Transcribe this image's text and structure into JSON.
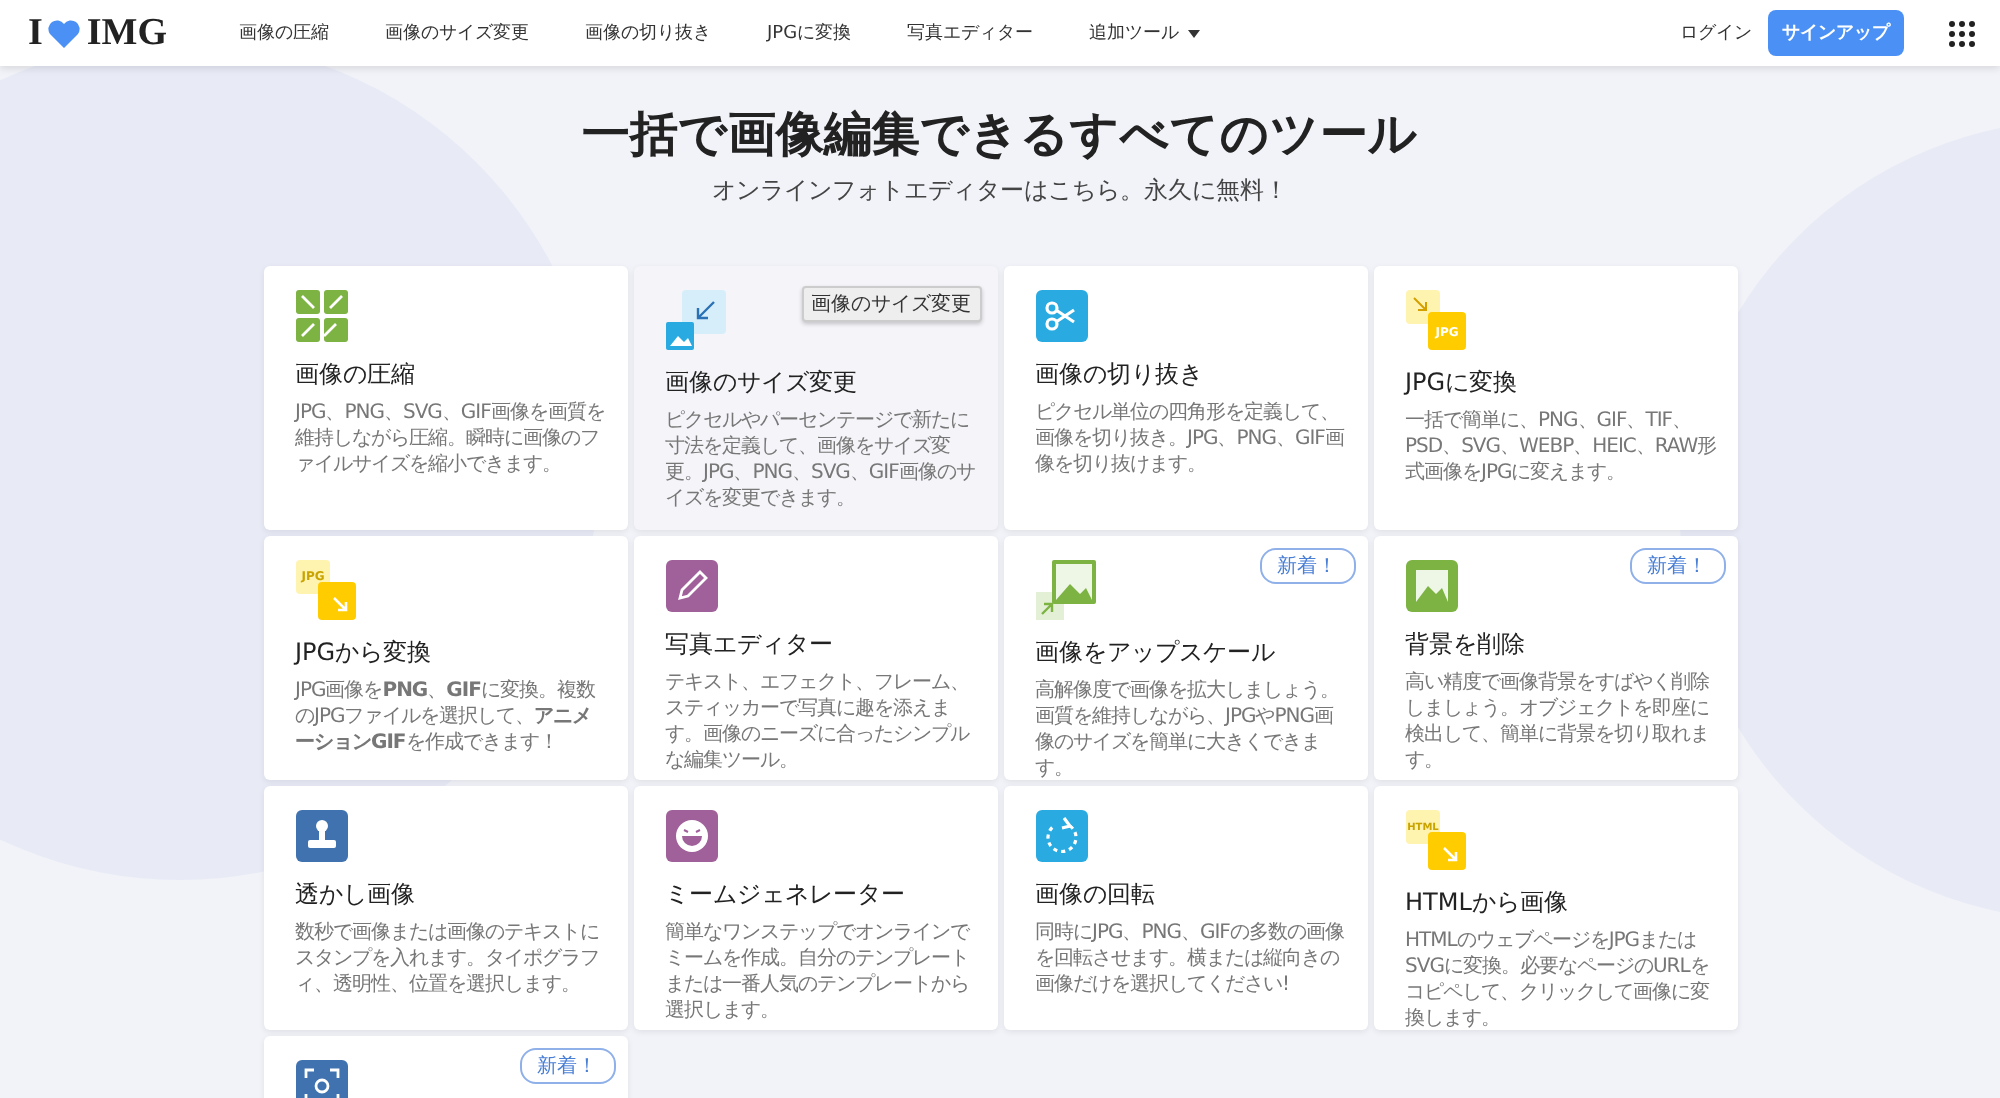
{
  "header": {
    "logo": {
      "left": "I",
      "right": "IMG"
    },
    "nav": [
      {
        "label": "画像の圧縮",
        "dropdown": false
      },
      {
        "label": "画像のサイズ変更",
        "dropdown": false
      },
      {
        "label": "画像の切り抜き",
        "dropdown": false
      },
      {
        "label": "JPGに変換",
        "dropdown": false
      },
      {
        "label": "写真エディター",
        "dropdown": false
      },
      {
        "label": "追加ツール",
        "dropdown": true
      }
    ],
    "login": "ログイン",
    "signup": "サインアップ"
  },
  "hero": {
    "title": "一括で画像編集できるすべてのツール",
    "subtitle": "オンラインフォトエディターはこちら。永久に無料！"
  },
  "tooltip": "画像のサイズ変更",
  "cards": [
    {
      "title": "画像の圧縮",
      "description": "JPG、PNG、SVG、GIF画像を画質を維持しながら圧縮。瞬時に画像のファイルサイズを縮小できます。",
      "icon": {
        "kind": "compress",
        "color": "#7cb342"
      },
      "hovered": false
    },
    {
      "title": "画像のサイズ変更",
      "description": "ピクセルやパーセンテージで新たに寸法を定義して、画像をサイズ変更。JPG、PNG、SVG、GIF画像のサイズを変更できます。",
      "icon": {
        "kind": "resize",
        "color": "#29abe2"
      },
      "hovered": true
    },
    {
      "title": "画像の切り抜き",
      "description": "ピクセル単位の四角形を定義して、画像を切り抜き。JPG、PNG、GIF画像を切り抜けます。",
      "icon": {
        "kind": "crop",
        "color": "#29abe2"
      },
      "hovered": false
    },
    {
      "title": "JPGに変換",
      "description": "一括で簡単に、PNG、GIF、TIF、PSD、SVG、WEBP、HEIC、RAW形式画像をJPGに変えます。",
      "icon": {
        "kind": "format",
        "color": "#ffcc00",
        "label": "JPG",
        "corner": true
      },
      "hovered": false
    },
    {
      "title": "JPGから変換",
      "description": "JPG画像を**PNG**、**GIF**に変換。複数のJPGファイルを選択して、**アニメーションGIF**を作成できます！",
      "icon": {
        "kind": "format",
        "color": "#ffcc00",
        "label": "JPG",
        "corner": false
      },
      "hovered": false
    },
    {
      "title": "写真エディター",
      "description": "テキスト、エフェクト、フレーム、スティッカーで写真に趣を添えます。画像のニーズに合ったシンプルな編集ツール。",
      "icon": {
        "kind": "pencil",
        "color": "#a0609a"
      },
      "hovered": false
    },
    {
      "title": "画像をアップスケール",
      "description": "高解像度で画像を拡大しましょう。画質を維持しながら、JPGやPNG画像のサイズを簡単に大きくできます。",
      "icon": {
        "kind": "upscale",
        "color": "#7cb342"
      },
      "badge": "新着！",
      "hovered": false
    },
    {
      "title": "背景を削除",
      "description": "高い精度で画像背景をすばやく削除しましょう。オブジェクトを即座に検出して、簡単に背景を切り取れます。",
      "icon": {
        "kind": "background",
        "color": "#7cb342"
      },
      "badge": "新着！",
      "hovered": false
    },
    {
      "title": "透かし画像",
      "description": "数秒で画像または画像のテキストにスタンプを入れます。タイポグラフィ、透明性、位置を選択します。",
      "icon": {
        "kind": "stamp",
        "color": "#3f72af"
      },
      "hovered": false
    },
    {
      "title": "ミームジェネレーター",
      "description": "簡単なワンステップでオンラインでミームを作成。自分のテンプレートまたは一番人気のテンプレートから選択します。",
      "icon": {
        "kind": "smile",
        "color": "#a0609a"
      },
      "hovered": false
    },
    {
      "title": "画像の回転",
      "description": "同時にJPG、PNG、GIFの多数の画像を回転させます。横または縦向きの画像だけを選択してください!",
      "icon": {
        "kind": "rotate",
        "color": "#29abe2"
      },
      "hovered": false
    },
    {
      "title": "HTMLから画像",
      "description": "HTMLのウェブページをJPGまたはSVGに変換。必要なページのURLをコピペして、クリックして画像に変換します。",
      "icon": {
        "kind": "format",
        "color": "#ffcc00",
        "label": "HTML",
        "corner": false
      },
      "hovered": false
    },
    {
      "icon": {
        "kind": "scan",
        "color": "#3f72af"
      },
      "badge": "新着！",
      "hovered": false
    }
  ]
}
